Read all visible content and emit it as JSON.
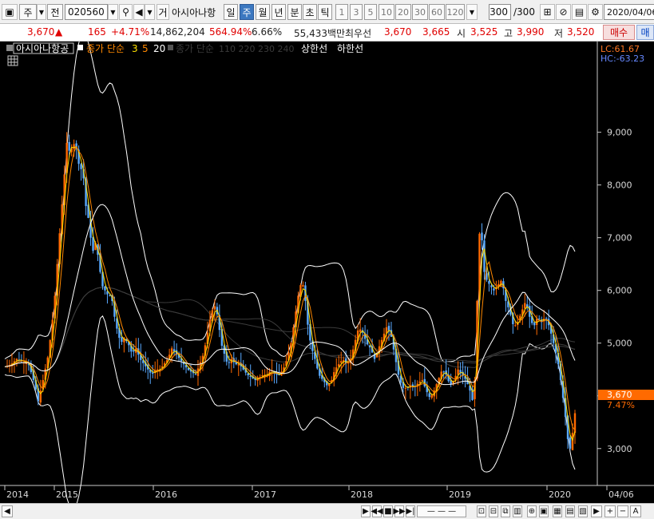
{
  "toolbar": {
    "market_label": "주",
    "period_label": "전",
    "code": "020560",
    "name": "아시아나항",
    "name_prefix": "거",
    "periods": [
      "일",
      "주",
      "월",
      "년",
      "분",
      "초",
      "틱"
    ],
    "active_period": "주",
    "numbers": [
      "1",
      "3",
      "5",
      "10",
      "20",
      "30",
      "60",
      "120"
    ],
    "count": "300",
    "count_total": "/300",
    "date": "2020/04/06"
  },
  "quote": {
    "price": "3,670",
    "arrow": "▲",
    "change": "165",
    "change_pct": "+4.71%",
    "volume": "14,862,204",
    "volume_ratio": "564.94%",
    "turnover": "6.66%",
    "amount": "55,433백만",
    "bid_label": "최우선",
    "bid1": "3,670",
    "bid2": "3,665",
    "open_label": "시",
    "open": "3,525",
    "high_label": "고",
    "high": "3,990",
    "low_label": "저",
    "low": "3,520",
    "buy": "매수",
    "sell": "매"
  },
  "chart_data": {
    "type": "candlestick",
    "title": "아시아나항공",
    "legend": {
      "ma_label": "종가 단순",
      "ma_periods": [
        "3",
        "5",
        "20"
      ],
      "ma_long_label": "종가 단순",
      "ma_long_periods": "110 220 230 240",
      "upper_label": "상한선",
      "lower_label": "하한선"
    },
    "lc_label": "LC:61.67",
    "hc_label": "HC:-63.23",
    "y_ticks": [
      "9,000",
      "8,000",
      "7,000",
      "6,000",
      "5,000",
      "4,000",
      "3,000"
    ],
    "y_range": [
      2300,
      10600
    ],
    "x_labels": [
      "2014",
      "2015",
      "2016",
      "2017",
      "2018",
      "2019",
      "2020",
      "04/06"
    ],
    "current_price": "3,670",
    "current_change": "7.47%",
    "close_points": [
      [
        0,
        4550
      ],
      [
        8,
        4600
      ],
      [
        15,
        4700
      ],
      [
        22,
        4650
      ],
      [
        30,
        4600
      ],
      [
        38,
        4200
      ],
      [
        42,
        3900
      ],
      [
        48,
        4300
      ],
      [
        55,
        4800
      ],
      [
        62,
        5700
      ],
      [
        68,
        6900
      ],
      [
        74,
        8000
      ],
      [
        78,
        8800
      ],
      [
        82,
        8600
      ],
      [
        86,
        8800
      ],
      [
        90,
        8700
      ],
      [
        94,
        8300
      ],
      [
        98,
        8300
      ],
      [
        102,
        7600
      ],
      [
        106,
        7300
      ],
      [
        110,
        6700
      ],
      [
        114,
        6900
      ],
      [
        118,
        6600
      ],
      [
        122,
        6100
      ],
      [
        126,
        6000
      ],
      [
        130,
        5900
      ],
      [
        134,
        5900
      ],
      [
        138,
        5500
      ],
      [
        142,
        5200
      ],
      [
        146,
        5000
      ],
      [
        150,
        5100
      ],
      [
        155,
        5000
      ],
      [
        160,
        4800
      ],
      [
        165,
        4900
      ],
      [
        170,
        4700
      ],
      [
        175,
        4600
      ],
      [
        180,
        4500
      ],
      [
        185,
        4400
      ],
      [
        190,
        4500
      ],
      [
        195,
        4500
      ],
      [
        200,
        4600
      ],
      [
        205,
        4700
      ],
      [
        210,
        4900
      ],
      [
        215,
        4800
      ],
      [
        220,
        4700
      ],
      [
        225,
        4600
      ],
      [
        230,
        4500
      ],
      [
        235,
        4450
      ],
      [
        240,
        4400
      ],
      [
        245,
        4600
      ],
      [
        250,
        4800
      ],
      [
        255,
        5200
      ],
      [
        260,
        5600
      ],
      [
        264,
        5700
      ],
      [
        268,
        5500
      ],
      [
        272,
        5000
      ],
      [
        276,
        4800
      ],
      [
        280,
        4600
      ],
      [
        285,
        4700
      ],
      [
        290,
        4600
      ],
      [
        295,
        4600
      ],
      [
        300,
        4500
      ],
      [
        305,
        4400
      ],
      [
        310,
        4350
      ],
      [
        315,
        4300
      ],
      [
        320,
        4350
      ],
      [
        325,
        4400
      ],
      [
        330,
        4400
      ],
      [
        335,
        4500
      ],
      [
        340,
        4400
      ],
      [
        345,
        4400
      ],
      [
        350,
        4500
      ],
      [
        355,
        4700
      ],
      [
        360,
        5000
      ],
      [
        365,
        5500
      ],
      [
        370,
        6000
      ],
      [
        374,
        6200
      ],
      [
        378,
        5800
      ],
      [
        382,
        5200
      ],
      [
        386,
        4900
      ],
      [
        390,
        4700
      ],
      [
        395,
        4400
      ],
      [
        400,
        4300
      ],
      [
        405,
        4200
      ],
      [
        410,
        4250
      ],
      [
        415,
        4500
      ],
      [
        420,
        4600
      ],
      [
        425,
        4700
      ],
      [
        430,
        4600
      ],
      [
        435,
        4700
      ],
      [
        440,
        5000
      ],
      [
        445,
        5300
      ],
      [
        450,
        5200
      ],
      [
        455,
        5000
      ],
      [
        460,
        4900
      ],
      [
        465,
        4700
      ],
      [
        470,
        4900
      ],
      [
        475,
        5100
      ],
      [
        480,
        5300
      ],
      [
        485,
        5200
      ],
      [
        490,
        4800
      ],
      [
        495,
        4400
      ],
      [
        500,
        4150
      ],
      [
        505,
        4150
      ],
      [
        510,
        4200
      ],
      [
        515,
        4150
      ],
      [
        520,
        4250
      ],
      [
        525,
        4300
      ],
      [
        530,
        4100
      ],
      [
        535,
        3950
      ],
      [
        540,
        4100
      ],
      [
        545,
        4300
      ],
      [
        550,
        4500
      ],
      [
        555,
        4400
      ],
      [
        560,
        4200
      ],
      [
        565,
        4300
      ],
      [
        570,
        4500
      ],
      [
        575,
        4400
      ],
      [
        580,
        4300
      ],
      [
        585,
        4100
      ],
      [
        590,
        3800
      ],
      [
        594,
        5800
      ],
      [
        598,
        7500
      ],
      [
        602,
        6400
      ],
      [
        606,
        6200
      ],
      [
        610,
        6100
      ],
      [
        615,
        6000
      ],
      [
        620,
        6100
      ],
      [
        625,
        6200
      ],
      [
        630,
        5800
      ],
      [
        635,
        5600
      ],
      [
        640,
        5300
      ],
      [
        645,
        5400
      ],
      [
        650,
        5600
      ],
      [
        655,
        5800
      ],
      [
        660,
        5500
      ],
      [
        665,
        5300
      ],
      [
        670,
        5500
      ],
      [
        675,
        5400
      ],
      [
        680,
        5500
      ],
      [
        685,
        5300
      ],
      [
        690,
        5000
      ],
      [
        695,
        4700
      ],
      [
        700,
        4200
      ],
      [
        705,
        3600
      ],
      [
        710,
        2900
      ],
      [
        714,
        3300
      ],
      [
        717,
        3670
      ]
    ]
  },
  "status": {
    "buttons": [
      "◀",
      "▶",
      "◀",
      "▶"
    ]
  }
}
